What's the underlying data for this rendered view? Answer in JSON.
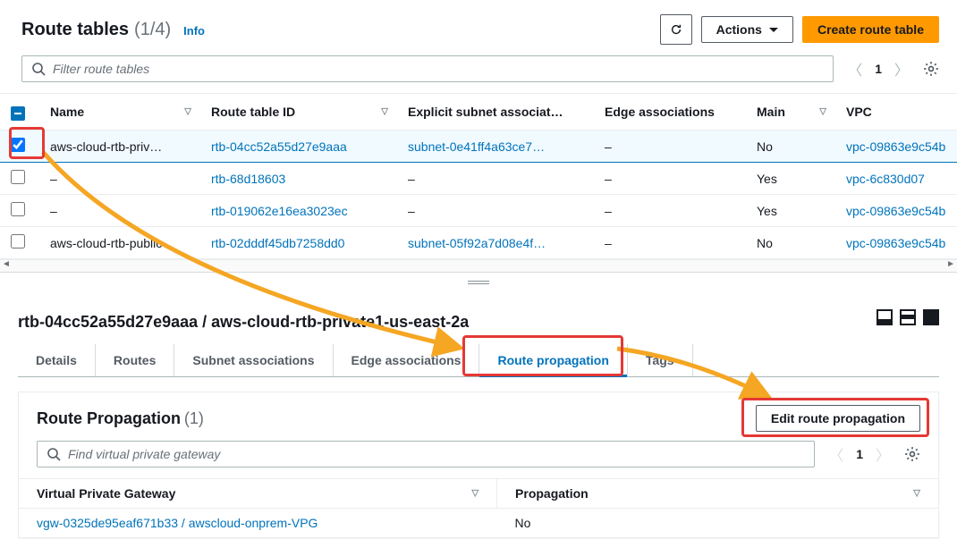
{
  "header": {
    "title": "Route tables",
    "count_display": "(1/4)",
    "info_label": "Info",
    "refresh_aria": "Refresh",
    "actions_label": "Actions",
    "create_label": "Create route table"
  },
  "search": {
    "placeholder": "Filter route tables",
    "page_number": "1"
  },
  "table": {
    "columns": {
      "name": "Name",
      "route_table_id": "Route table ID",
      "explicit_subnet": "Explicit subnet associat…",
      "edge": "Edge associations",
      "main": "Main",
      "vpc": "VPC"
    },
    "rows": [
      {
        "selected": true,
        "name": "aws-cloud-rtb-priv…",
        "rtb_id": "rtb-04cc52a55d27e9aaa",
        "subnet": "subnet-0e41ff4a63ce72…",
        "edge": "–",
        "main": "No",
        "vpc": "vpc-09863e9c54b"
      },
      {
        "selected": false,
        "name": "–",
        "rtb_id": "rtb-68d18603",
        "subnet": "–",
        "edge": "–",
        "main": "Yes",
        "vpc": "vpc-6c830d07"
      },
      {
        "selected": false,
        "name": "–",
        "rtb_id": "rtb-019062e16ea3023ec",
        "subnet": "–",
        "edge": "–",
        "main": "Yes",
        "vpc": "vpc-09863e9c54b"
      },
      {
        "selected": false,
        "name": "aws-cloud-rtb-public",
        "rtb_id": "rtb-02dddf45db7258dd0",
        "subnet": "subnet-05f92a7d08e4f…",
        "edge": "–",
        "main": "No",
        "vpc": "vpc-09863e9c54b"
      }
    ]
  },
  "detail": {
    "breadcrumb": "rtb-04cc52a55d27e9aaa / aws-cloud-rtb-private1-us-east-2a",
    "tabs": {
      "details": "Details",
      "routes": "Routes",
      "subnet_assoc": "Subnet associations",
      "edge_assoc": "Edge associations",
      "route_prop": "Route propagation",
      "tags": "Tags"
    },
    "propagation": {
      "section_title": "Route Propagation",
      "section_count": "(1)",
      "edit_button": "Edit route propagation",
      "search_placeholder": "Find virtual private gateway",
      "page_number": "1",
      "columns": {
        "vgw": "Virtual Private Gateway",
        "prop": "Propagation"
      },
      "rows": [
        {
          "vgw": "vgw-0325de95eaf671b33 / awscloud-onprem-VPG",
          "prop": "No"
        }
      ]
    }
  }
}
